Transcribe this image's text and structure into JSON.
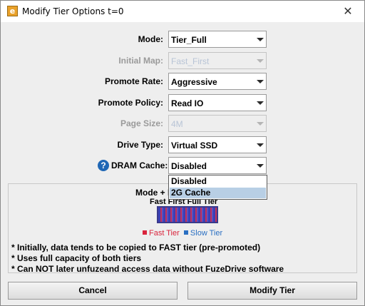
{
  "window": {
    "title": "Modify Tier Options t=0",
    "icon_letter": "e",
    "close_glyph": "✕"
  },
  "form": {
    "mode": {
      "label": "Mode:",
      "value": "Tier_Full",
      "enabled": true
    },
    "initial_map": {
      "label": "Initial Map:",
      "value": "Fast_First",
      "enabled": false
    },
    "promote_rate": {
      "label": "Promote Rate:",
      "value": "Aggressive",
      "enabled": true
    },
    "promote_policy": {
      "label": "Promote Policy:",
      "value": "Read IO",
      "enabled": true
    },
    "page_size": {
      "label": "Page Size:",
      "value": "4M",
      "enabled": false
    },
    "drive_type": {
      "label": "Drive Type:",
      "value": "Virtual SSD",
      "enabled": true
    },
    "dram_cache": {
      "label": "DRAM Cache:",
      "value": "Disabled",
      "enabled": true,
      "help_glyph": "?"
    }
  },
  "dram_dropdown": {
    "options": [
      "Disabled",
      "2G Cache"
    ],
    "highlighted": "2G Cache"
  },
  "description": {
    "title": "Mode + I",
    "subtitle": "Fast First Full Tier",
    "legend": {
      "fast": "Fast Tier",
      "slow": "Slow Tier"
    },
    "bullets": [
      "* Initially, data tends to be copied to FAST tier (pre-promoted)",
      "* Uses full capacity of both tiers",
      "* Can NOT later unfuzeand access data without FuzeDrive software"
    ]
  },
  "buttons": {
    "cancel": "Cancel",
    "modify": "Modify Tier"
  },
  "colors": {
    "fast_tier": "#d9243c",
    "slow_tier": "#2a6fc2",
    "highlight": "#b8cfe5",
    "help_icon": "#1f67b5"
  }
}
